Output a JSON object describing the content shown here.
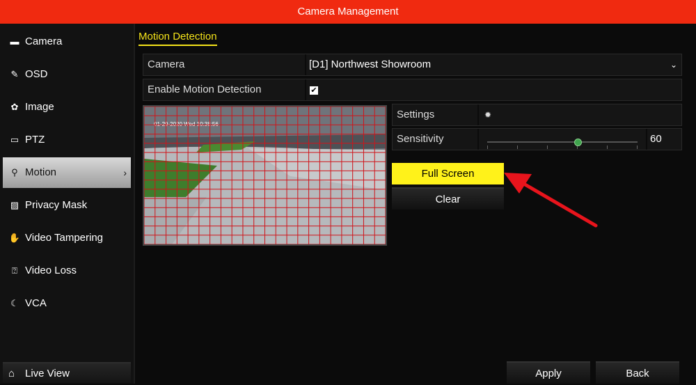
{
  "window": {
    "title": "Camera Management"
  },
  "sidebar": {
    "items": [
      {
        "label": "Camera",
        "icon": "camera-icon",
        "active": false
      },
      {
        "label": "OSD",
        "icon": "osd-icon",
        "active": false
      },
      {
        "label": "Image",
        "icon": "image-icon",
        "active": false
      },
      {
        "label": "PTZ",
        "icon": "ptz-icon",
        "active": false
      },
      {
        "label": "Motion",
        "icon": "motion-icon",
        "active": true
      },
      {
        "label": "Privacy Mask",
        "icon": "privacy-mask-icon",
        "active": false
      },
      {
        "label": "Video Tampering",
        "icon": "hand-icon",
        "active": false
      },
      {
        "label": "Video Loss",
        "icon": "video-loss-icon",
        "active": false
      },
      {
        "label": "VCA",
        "icon": "vca-icon",
        "active": false
      }
    ],
    "live_view": "Live View"
  },
  "main": {
    "tab": "Motion Detection",
    "camera": {
      "label": "Camera",
      "value": "[D1] Northwest Showroom"
    },
    "enable": {
      "label": "Enable Motion Detection",
      "checked": true
    },
    "settings": {
      "label": "Settings"
    },
    "sensitivity": {
      "label": "Sensitivity",
      "value": "60",
      "level": 0.6
    },
    "preview": {
      "timestamp": "01-29-2020 Wed 10:38:56"
    },
    "buttons": {
      "full_screen": "Full Screen",
      "clear": "Clear",
      "apply": "Apply",
      "back": "Back"
    }
  },
  "colors": {
    "accent": "#f02a10",
    "highlight": "#fff21a",
    "grid": "#d0141a",
    "annotation_arrow": "#e8141c"
  }
}
